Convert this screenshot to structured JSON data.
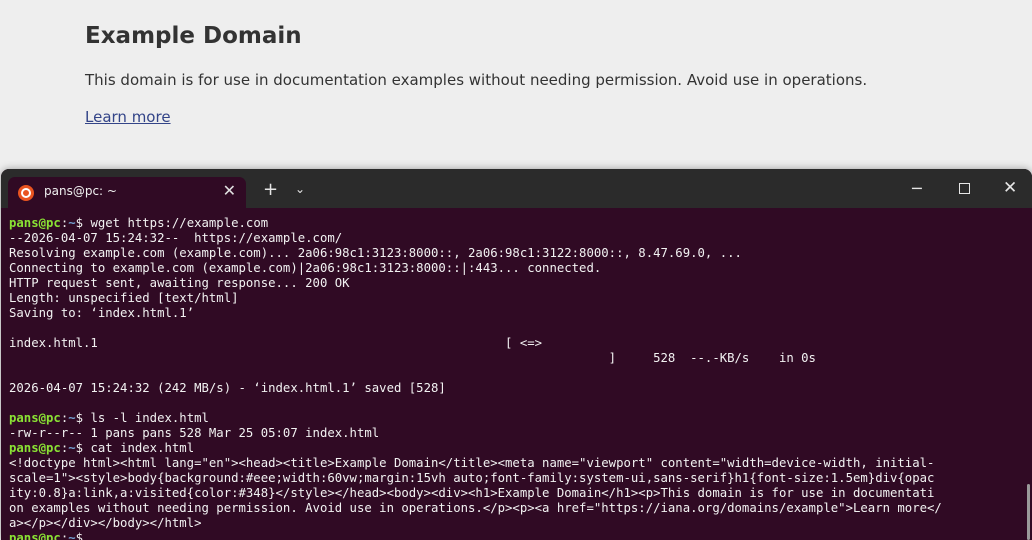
{
  "webpage": {
    "title": "Example Domain",
    "description": "This domain is for use in documentation examples without needing permission. Avoid use in operations.",
    "learn_more": "Learn more"
  },
  "terminal": {
    "tab_title": "pans@pc: ~",
    "tab_close": "✕",
    "new_tab": "+",
    "dropdown": "⌄",
    "minimize": "─",
    "close": "✕",
    "prompt": {
      "user": "pans@pc",
      "sep": ":",
      "path": "~",
      "symbol": "$ "
    },
    "lines": [
      {
        "type": "prompt",
        "cmd": "wget https://example.com"
      },
      {
        "type": "out",
        "text": "--2026-04-07 15:24:32--  https://example.com/"
      },
      {
        "type": "out",
        "text": "Resolving example.com (example.com)... 2a06:98c1:3123:8000::, 2a06:98c1:3122:8000::, 8.47.69.0, ..."
      },
      {
        "type": "out",
        "text": "Connecting to example.com (example.com)|2a06:98c1:3123:8000::|:443... connected."
      },
      {
        "type": "out",
        "text": "HTTP request sent, awaiting response... 200 OK"
      },
      {
        "type": "out",
        "text": "Length: unspecified [text/html]"
      },
      {
        "type": "out",
        "text": "Saving to: ‘index.html.1’"
      },
      {
        "type": "out",
        "text": ""
      },
      {
        "type": "out",
        "text": "index.html.1                                                       [ <=>"
      },
      {
        "type": "out",
        "text": "                                                                                 ]     528  --.-KB/s    in 0s"
      },
      {
        "type": "out",
        "text": ""
      },
      {
        "type": "out",
        "text": "2026-04-07 15:24:32 (242 MB/s) - ‘index.html.1’ saved [528]"
      },
      {
        "type": "out",
        "text": ""
      },
      {
        "type": "prompt",
        "cmd": "ls -l index.html"
      },
      {
        "type": "out",
        "text": "-rw-r--r-- 1 pans pans 528 Mar 25 05:07 index.html"
      },
      {
        "type": "prompt",
        "cmd": "cat index.html"
      },
      {
        "type": "out",
        "text": "<!doctype html><html lang=\"en\"><head><title>Example Domain</title><meta name=\"viewport\" content=\"width=device-width, initial-"
      },
      {
        "type": "out",
        "text": "scale=1\"><style>body{background:#eee;width:60vw;margin:15vh auto;font-family:system-ui,sans-serif}h1{font-size:1.5em}div{opac"
      },
      {
        "type": "out",
        "text": "ity:0.8}a:link,a:visited{color:#348}</style></head><body><div><h1>Example Domain</h1><p>This domain is for use in documentati"
      },
      {
        "type": "out",
        "text": "on examples without needing permission. Avoid use in operations.</p><p><a href=\"https://iana.org/domains/example\">Learn more</"
      },
      {
        "type": "out",
        "text": "a></p></div></body></html>"
      },
      {
        "type": "prompt",
        "cmd": ""
      }
    ]
  },
  "colors": {
    "terminal_bg": "#300a24",
    "titlebar_bg": "#2b2b2b",
    "prompt_user": "#8ae234",
    "prompt_path": "#729fcf",
    "link": "#334488"
  }
}
